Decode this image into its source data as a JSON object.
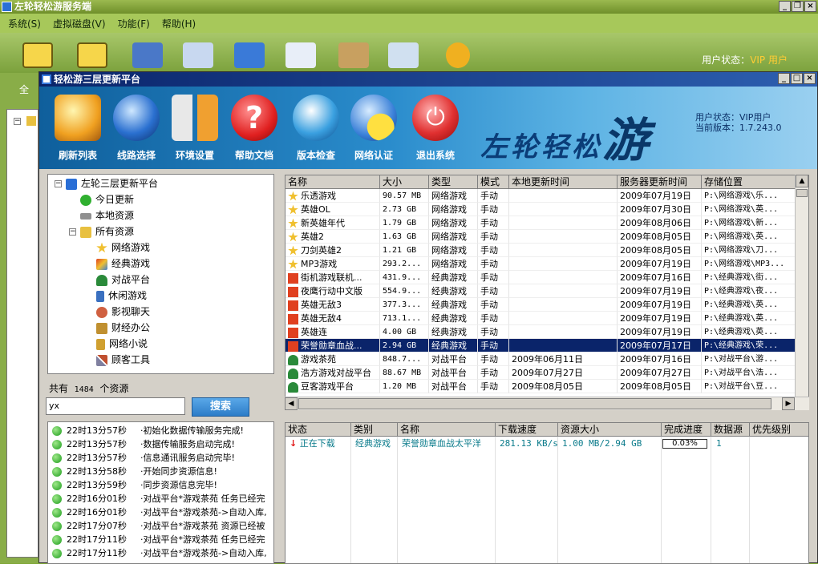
{
  "outer": {
    "title": "左轮轻松游服务端",
    "menu": [
      "系统(S)",
      "虚拟磁盘(V)",
      "功能(F)",
      "帮助(H)"
    ],
    "status_label": "用户状态：",
    "status_value": "VIP 用户",
    "left_tab": "全"
  },
  "inner": {
    "title": "轻松游三层更新平台",
    "toolbar": [
      {
        "label": "刷新列表",
        "icon": "refresh-list-icon",
        "color": "#f0a020"
      },
      {
        "label": "线路选择",
        "icon": "route-globe-icon",
        "color": "#2a70d0"
      },
      {
        "label": "环境设置",
        "icon": "wrench-icon",
        "color": "#e8e8e8"
      },
      {
        "label": "帮助文档",
        "icon": "help-magnifier-icon",
        "color": "#e02020"
      },
      {
        "label": "版本检查",
        "icon": "version-globe-icon",
        "color": "#3aa0e0"
      },
      {
        "label": "网络认证",
        "icon": "network-auth-icon",
        "color": "#3a80d8"
      },
      {
        "label": "退出系统",
        "icon": "power-exit-icon",
        "color": "#e03030"
      }
    ],
    "logo": {
      "text": "左轮轻松",
      "big": "游"
    },
    "user_status": "用户状态：VIP用户",
    "current_version": "当前版本：1.7.243.0"
  },
  "tree": {
    "root": "左轮三层更新平台",
    "items": [
      {
        "label": "今日更新",
        "icon": "check-icon",
        "color": "#30b030"
      },
      {
        "label": "本地资源",
        "icon": "local-disk-icon",
        "color": "#909090"
      },
      {
        "label": "所有资源",
        "icon": "folder-icon",
        "color": "#e8c040"
      },
      {
        "label": "网络游戏",
        "icon": "star-icon",
        "color": "#f0c030"
      },
      {
        "label": "经典游戏",
        "icon": "classic-game-icon",
        "color": "#e04020"
      },
      {
        "label": "对战平台",
        "icon": "users-icon",
        "color": "#2a8a3a"
      },
      {
        "label": "休闲游戏",
        "icon": "casual-game-icon",
        "color": "#3a70c0"
      },
      {
        "label": "影视聊天",
        "icon": "chat-icon",
        "color": "#d06040"
      },
      {
        "label": "财经办公",
        "icon": "finance-icon",
        "color": "#c09030"
      },
      {
        "label": "网络小说",
        "icon": "novel-icon",
        "color": "#d0a030"
      },
      {
        "label": "顾客工具",
        "icon": "tools-icon",
        "color": "#8080a0"
      }
    ]
  },
  "count": {
    "prefix": "共有",
    "value": "1484",
    "suffix": "个资源"
  },
  "search": {
    "value": "yx",
    "button": "搜索"
  },
  "log": [
    {
      "time": "22时13分57秒",
      "msg": "·初始化数据传输服务完成!"
    },
    {
      "time": "22时13分57秒",
      "msg": "·数据传输服务启动完成!"
    },
    {
      "time": "22时13分57秒",
      "msg": "·信息通讯服务启动完毕!"
    },
    {
      "time": "22时13分58秒",
      "msg": "·开始同步资源信息!"
    },
    {
      "time": "22时13分59秒",
      "msg": "·同步资源信息完毕!"
    },
    {
      "time": "22时16分01秒",
      "msg": "·对战平台*游戏茶苑 任务已经完"
    },
    {
      "time": "22时16分01秒",
      "msg": "·对战平台*游戏茶苑->自动入库,"
    },
    {
      "time": "22时17分07秒",
      "msg": "·对战平台*游戏茶苑 资源已经被"
    },
    {
      "time": "22时17分11秒",
      "msg": "·对战平台*游戏茶苑 任务已经完"
    },
    {
      "time": "22时17分11秒",
      "msg": "·对战平台*游戏茶苑->自动入库,"
    }
  ],
  "grid": {
    "headers": [
      "名称",
      "大小",
      "类型",
      "模式",
      "本地更新时间",
      "服务器更新时间",
      "存储位置"
    ],
    "rows": [
      {
        "name": "乐透游戏",
        "size": "90.57 MB",
        "type": "网络游戏",
        "mode": "手动",
        "local": "",
        "server": "2009年07月19日",
        "path": "P:\\网络游戏\\乐...",
        "icon": "star-icon",
        "color": "#f0c030"
      },
      {
        "name": "英雄OL",
        "size": "2.73 GB",
        "type": "网络游戏",
        "mode": "手动",
        "local": "",
        "server": "2009年07月30日",
        "path": "P:\\网络游戏\\英...",
        "icon": "star-icon",
        "color": "#f0c030"
      },
      {
        "name": "新英雄年代",
        "size": "1.79 GB",
        "type": "网络游戏",
        "mode": "手动",
        "local": "",
        "server": "2009年08月06日",
        "path": "P:\\网络游戏\\新...",
        "icon": "star-icon",
        "color": "#f0c030"
      },
      {
        "name": "英雄2",
        "size": "1.63 GB",
        "type": "网络游戏",
        "mode": "手动",
        "local": "",
        "server": "2009年08月05日",
        "path": "P:\\网络游戏\\英...",
        "icon": "star-icon",
        "color": "#f0c030"
      },
      {
        "name": "刀剑英雄2",
        "size": "1.21 GB",
        "type": "网络游戏",
        "mode": "手动",
        "local": "",
        "server": "2009年08月05日",
        "path": "P:\\网络游戏\\刀...",
        "icon": "star-icon",
        "color": "#f0c030"
      },
      {
        "name": "MP3游戏",
        "size": "293.2...",
        "type": "网络游戏",
        "mode": "手动",
        "local": "",
        "server": "2009年07月19日",
        "path": "P:\\网络游戏\\MP3...",
        "icon": "star-icon",
        "color": "#f0c030"
      },
      {
        "name": "街机游戏联机...",
        "size": "431.9...",
        "type": "经典游戏",
        "mode": "手动",
        "local": "",
        "server": "2009年07月16日",
        "path": "P:\\经典游戏\\街...",
        "icon": "classic-game-icon",
        "color": "#e04020"
      },
      {
        "name": "夜鹰行动中文版",
        "size": "554.9...",
        "type": "经典游戏",
        "mode": "手动",
        "local": "",
        "server": "2009年07月19日",
        "path": "P:\\经典游戏\\夜...",
        "icon": "classic-game-icon",
        "color": "#e04020"
      },
      {
        "name": "英雄无敌3",
        "size": "377.3...",
        "type": "经典游戏",
        "mode": "手动",
        "local": "",
        "server": "2009年07月19日",
        "path": "P:\\经典游戏\\英...",
        "icon": "classic-game-icon",
        "color": "#e04020"
      },
      {
        "name": "英雄无敌4",
        "size": "713.1...",
        "type": "经典游戏",
        "mode": "手动",
        "local": "",
        "server": "2009年07月19日",
        "path": "P:\\经典游戏\\英...",
        "icon": "classic-game-icon",
        "color": "#e04020"
      },
      {
        "name": "英雄连",
        "size": "4.00 GB",
        "type": "经典游戏",
        "mode": "手动",
        "local": "",
        "server": "2009年07月19日",
        "path": "P:\\经典游戏\\英...",
        "icon": "classic-game-icon",
        "color": "#e04020"
      },
      {
        "name": "荣誉勋章血战...",
        "size": "2.94 GB",
        "type": "经典游戏",
        "mode": "手动",
        "local": "",
        "server": "2009年07月17日",
        "path": "P:\\经典游戏\\荣...",
        "icon": "classic-game-icon",
        "color": "#e04020",
        "selected": true
      },
      {
        "name": "游戏茶苑",
        "size": "848.7...",
        "type": "对战平台",
        "mode": "手动",
        "local": "2009年06月11日",
        "server": "2009年07月16日",
        "path": "P:\\对战平台\\游...",
        "icon": "users-icon",
        "color": "#2a8a3a"
      },
      {
        "name": "浩方游戏对战平台",
        "size": "88.67 MB",
        "type": "对战平台",
        "mode": "手动",
        "local": "2009年07月27日",
        "server": "2009年07月27日",
        "path": "P:\\对战平台\\浩...",
        "icon": "users-icon",
        "color": "#2a8a3a"
      },
      {
        "name": "豆客游戏平台",
        "size": "1.20 MB",
        "type": "对战平台",
        "mode": "手动",
        "local": "2009年08月05日",
        "server": "2009年08月05日",
        "path": "P:\\对战平台\\豆...",
        "icon": "users-icon",
        "color": "#2a8a3a"
      }
    ]
  },
  "download": {
    "headers": [
      "状态",
      "类别",
      "名称",
      "下载速度",
      "资源大小",
      "完成进度",
      "数据源",
      "优先级别"
    ],
    "row": {
      "status": "正在下载",
      "category": "经典游戏",
      "name": "荣誉勋章血战太平洋",
      "speed": "281.13 KB/s",
      "size": "1.00 MB/2.94 GB",
      "progress": "0.03%",
      "sources": "1",
      "priority": ""
    }
  }
}
